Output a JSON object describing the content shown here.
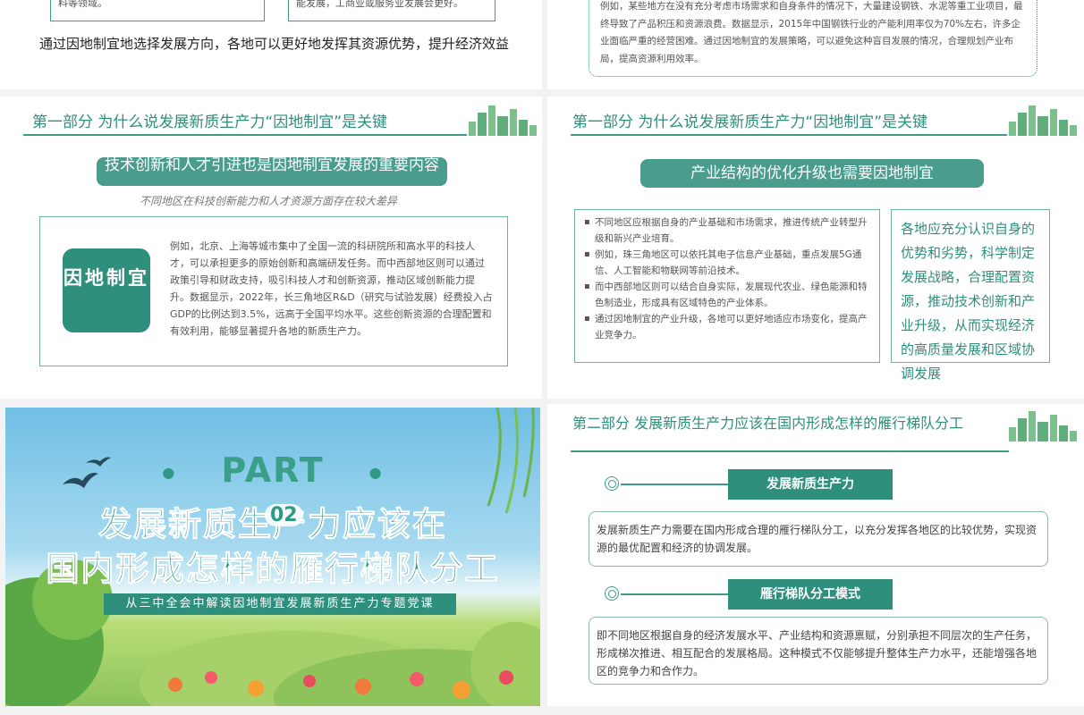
{
  "top_left": {
    "box1_text": "料等领域。",
    "box2_text": "能发展，工商业或服务业发展会更好。",
    "summary": "通过因地制宜地选择发展方向，各地可以更好地发挥其资源优势，提升经济效益"
  },
  "top_right": {
    "text": "例如，某些地方在没有充分考虑市场需求和自身条件的情况下，大量建设钢铁、水泥等重工业项目，最终导致了产品积压和资源浪费。数据显示，2015年中国钢铁行业的产能利用率仅为70%左右，许多企业面临严重的经营困难。通过因地制宜的发展策略，可以避免这种盲目发展的情况，合理规划产业布局，提高资源利用效率。"
  },
  "mid_left": {
    "section_title": "第一部分 为什么说发展新质生产力“因地制宜”是关键",
    "pill": "技术创新和人才引进也是因地制宜发展的重要内容",
    "subnote": "不同地区在科技创新能力和人才资源方面存在较大差异",
    "badge": "因地制宜",
    "body": "例如，北京、上海等城市集中了全国一流的科研院所和高水平的科技人才，可以承担更多的原始创新和高端研发任务。而中西部地区则可以通过政策引导和财政支持，吸引科技人才和创新资源，推动区域创新能力提升。数据显示，2022年，长三角地区R&D（研究与试验发展）经费投入占GDP的比例达到3.5%，远高于全国平均水平。这些创新资源的合理配置和有效利用，能够显著提升各地的新质生产力。"
  },
  "mid_right": {
    "section_title": "第一部分 为什么说发展新质生产力“因地制宜”是关键",
    "pill": "产业结构的优化升级也需要因地制宜",
    "bullets": [
      "不同地区应根据自身的产业基础和市场需求，推进传统产业转型升级和新兴产业培育。",
      "例如，珠三角地区可以依托其电子信息产业基础，重点发展5G通信、人工智能和物联网等前沿技术。",
      "而中西部地区则可以结合自身实际，发展现代农业、绿色能源和特色制造业，形成具有区域特色的产业体系。",
      "通过因地制宜的产业升级，各地可以更好地适应市场变化，提高产业竞争力。"
    ],
    "side_text": "各地应充分认识自身的优势和劣势，科学制定发展战略，合理配置资源，推动技术创新和产业升级，从而实现经济的高质量发展和区域协调发展"
  },
  "banner": {
    "part": "PART",
    "number": "02",
    "title_line1": "发展新质生产力应该在",
    "title_line2": "国内形成怎样的雁行梯队分工",
    "subtitle": "从三中全会中解读因地制宜发展新质生产力专题党课"
  },
  "bottom_right": {
    "section_title": "第二部分 发展新质生产力应该在国内形成怎样的雁行梯队分工",
    "heading1": "发展新质生产力",
    "text1": "发展新质生产力需要在国内形成合理的雁行梯队分工，以充分发挥各地区的比较优势，实现资源的最优配置和经济的协调发展。",
    "heading2": "雁行梯队分工模式",
    "text2": "即不同地区根据自身的经济发展水平、产业结构和资源禀赋，分别承担不同层次的生产任务，形成梯次推进、相互配合的发展格局。这种模式不仅能够提升整体生产力水平，还能增强各地区的竞争力和合作力。"
  },
  "colors": {
    "accent": "#2f8f7d",
    "light_accent": "#6fb0a1",
    "banner_sky": "#6fbfe4"
  },
  "icons": [
    "city-skyline-icon",
    "target-circle-icon",
    "bird-icon",
    "flower-icon",
    "tree-icon"
  ]
}
